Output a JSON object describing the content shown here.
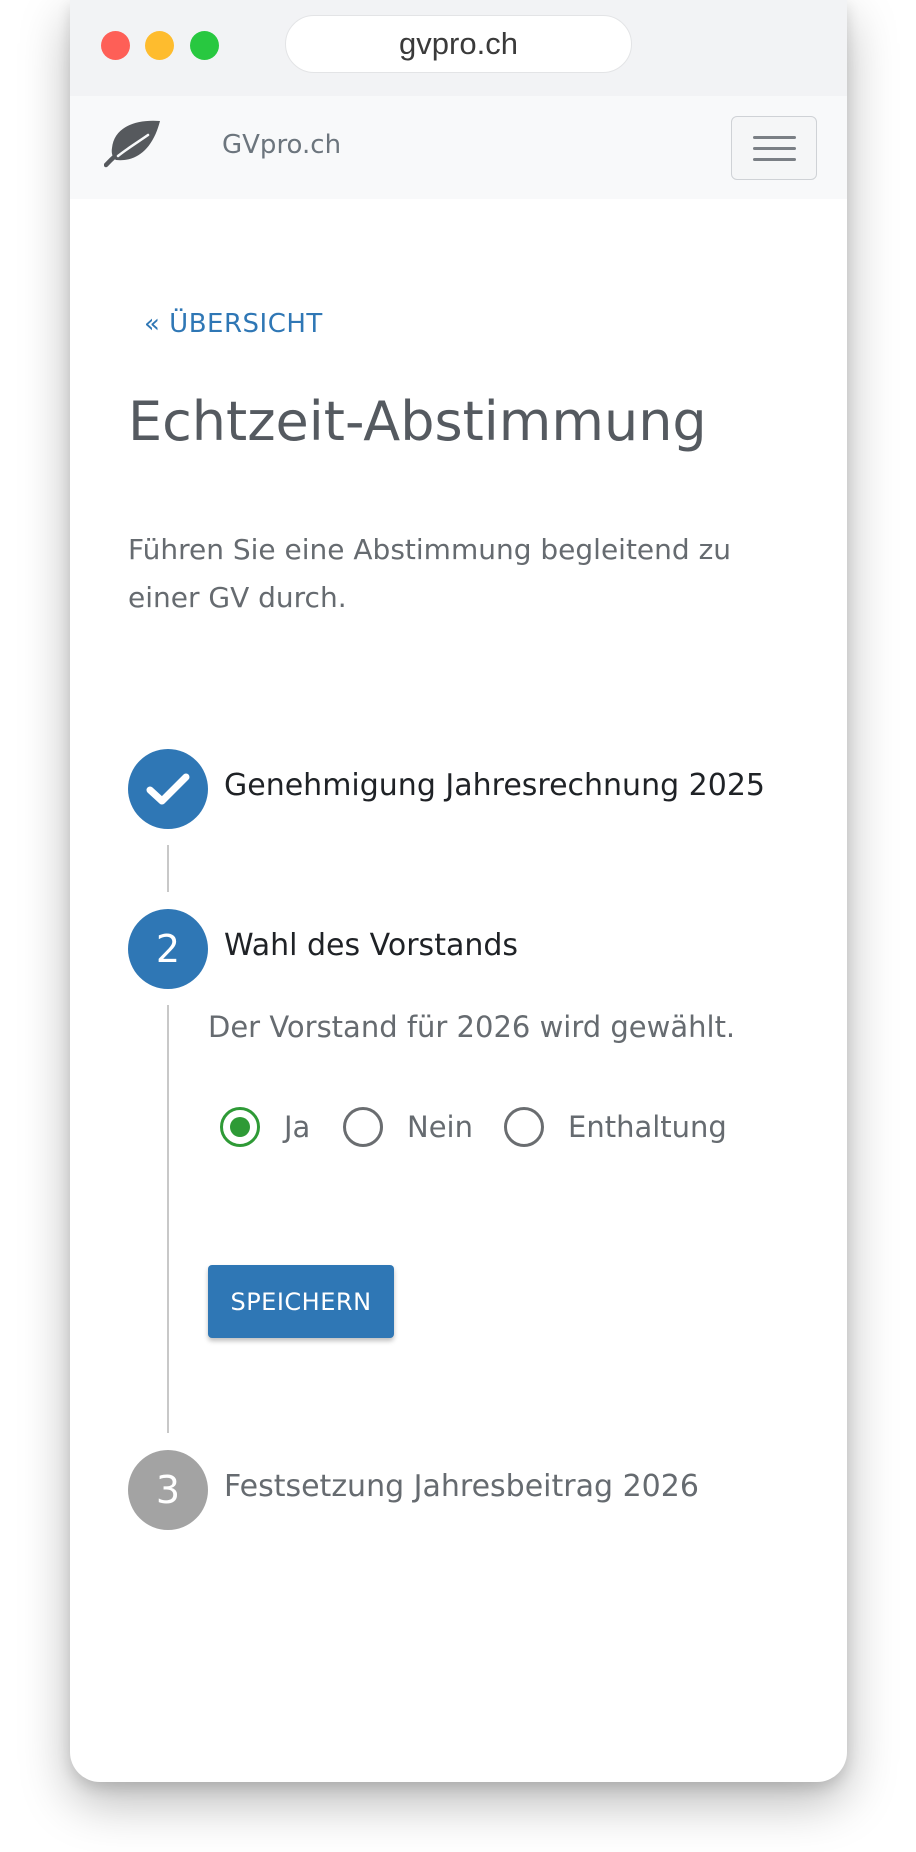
{
  "browser": {
    "url": "gvpro.ch"
  },
  "navbar": {
    "brand": "GVpro.ch",
    "logo_icon": "leaf-icon",
    "menu_icon": "hamburger-menu-icon"
  },
  "page": {
    "back_link": "« ÜBERSICHT",
    "title": "Echtzeit-Abstimmung",
    "lead": "Führen Sie eine Abstimmung begleitend zu einer GV durch."
  },
  "steps": [
    {
      "status": "completed",
      "icon": "checkmark-icon",
      "title": "Genehmigung Jahresrechnung 2025"
    },
    {
      "status": "active",
      "number": "2",
      "title": "Wahl des Vorstands",
      "description": "Der Vorstand für 2026 wird gewählt.",
      "options": [
        {
          "label": "Ja",
          "checked": true
        },
        {
          "label": "Nein",
          "checked": false
        },
        {
          "label": "Enthaltung",
          "checked": false
        }
      ],
      "save_label": "SPEICHERN"
    },
    {
      "status": "pending",
      "number": "3",
      "title": "Festsetzung Jahresbeitrag 2026"
    }
  ],
  "colors": {
    "primary": "#2f77b5",
    "radio_checked": "#2e9a36",
    "step_pending": "#a3a3a3"
  }
}
